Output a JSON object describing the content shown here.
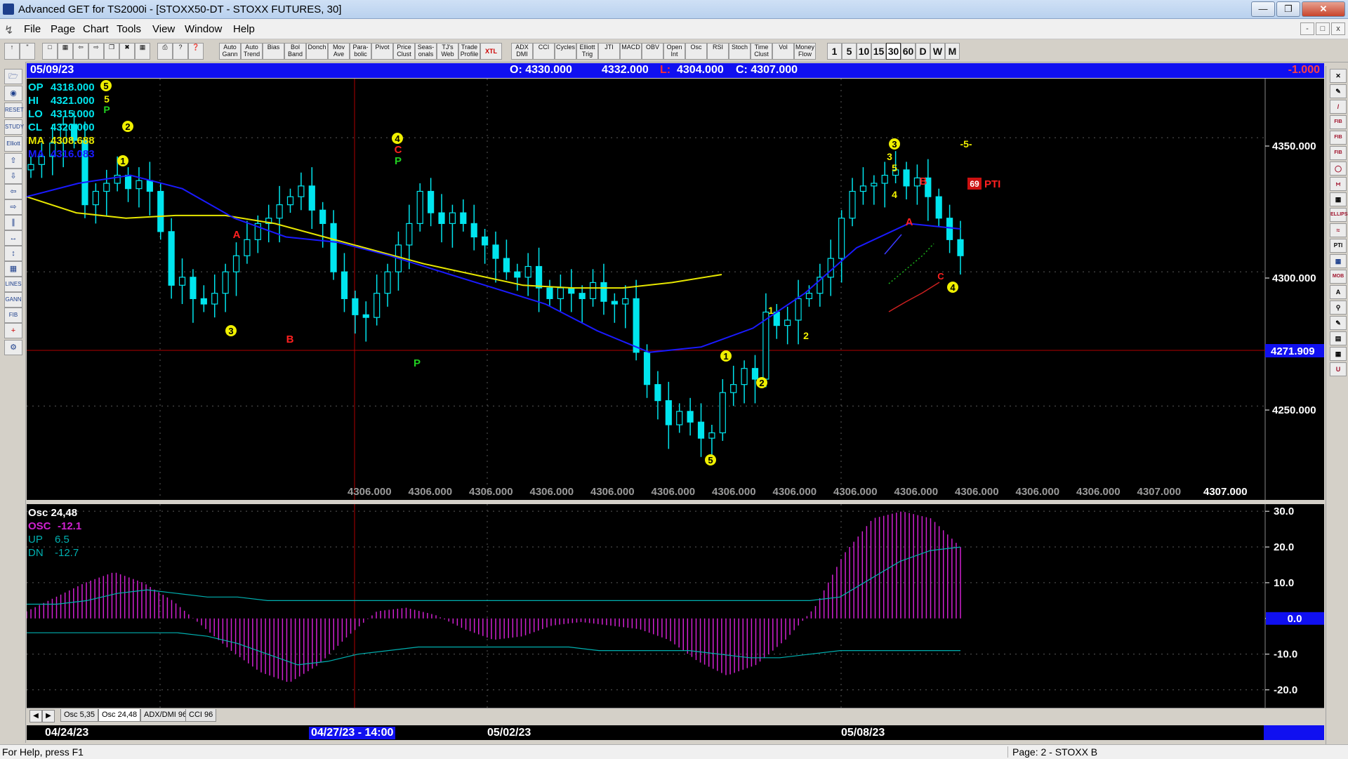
{
  "window": {
    "title": "Advanced GET for TS2000i - [STOXX50-DT - STOXX FUTURES, 30]"
  },
  "menu": [
    "File",
    "Page",
    "Chart",
    "Tools",
    "View",
    "Window",
    "Help"
  ],
  "toolbar": {
    "study_buttons": [
      "Auto Gann",
      "Auto Trend",
      "Bias",
      "Bol Band",
      "Donch",
      "Mov Ave",
      "Para- bolic",
      "Pivot",
      "Price Clust",
      "Seas- onals",
      "TJ's Web",
      "Trade Profile",
      "XTL",
      "ADX DMI",
      "CCI",
      "Cycles",
      "Elliott Trig",
      "JTI",
      "MACD",
      "OBV",
      "Open Int",
      "Osc",
      "RSI",
      "Stoch",
      "Time Clust",
      "Vol",
      "Money Flow"
    ],
    "periods": [
      "1",
      "5",
      "10",
      "15",
      "30",
      "60",
      "D",
      "W",
      "M"
    ],
    "active_period": "30"
  },
  "info_bar": {
    "date": "05/09/23",
    "open": "O: 4330.000",
    "high": "4332.000",
    "low": "L: 4304.000",
    "close": "C: 4307.000",
    "change": "-1.000"
  },
  "legend": {
    "op": {
      "label": "OP",
      "value": "4318.000"
    },
    "hi": {
      "label": "HI",
      "value": "4321.000"
    },
    "lo": {
      "label": "LO",
      "value": "4315.000"
    },
    "cl": {
      "label": "CL",
      "value": "4320.000"
    },
    "ma1": {
      "label": "MA",
      "value": "4308.688"
    },
    "ma2": {
      "label": "MA",
      "value": "4316.083"
    }
  },
  "price_axis": {
    "ticks": [
      "4350.000",
      "4300.000",
      "4250.000"
    ],
    "cursor_price": "4271.909"
  },
  "bottom_values": [
    "4306.000",
    "4306.000",
    "4306.000",
    "4306.000",
    "4306.000",
    "4306.000",
    "4306.000",
    "4306.000",
    "4306.000",
    "4306.000",
    "4306.000",
    "4306.000",
    "4306.000",
    "4307.000",
    "4307.000"
  ],
  "elliott_labels": {
    "wave5_top": "5",
    "wave3": "3",
    "wave4": "4",
    "wave5_low": "5",
    "wave1": "1",
    "wave2": "2",
    "wave3_top": "3",
    "wave4_end": "4",
    "waveA": "A",
    "waveB": "B",
    "waveC": "C",
    "pivotP": "P",
    "ptiValue": "69",
    "ptiText": "PTI",
    "wave5_target": "-5-",
    "small1": "1",
    "small2": "2",
    "small3": "3",
    "small4": "4",
    "small5": "5"
  },
  "oscillator": {
    "title": "Osc 24,48",
    "osc": {
      "label": "OSC",
      "value": "-12.1"
    },
    "up": {
      "label": "UP",
      "value": "6.5"
    },
    "dn": {
      "label": "DN",
      "value": "-12.7"
    },
    "ticks": [
      "30.0",
      "20.0",
      "10.0",
      "0.0",
      "-10.0",
      "-20.0"
    ]
  },
  "tabs": [
    "Osc 5,35",
    "Osc 24,48",
    "ADX/DMI 96",
    "CCI 96"
  ],
  "active_tab": "Osc 24,48",
  "date_axis": {
    "labels": [
      "04/24/23",
      "05/02/23",
      "05/08/23"
    ],
    "cursor_label": "04/27/23 - 14:00"
  },
  "status": {
    "help": "For Help, press F1",
    "page": "Page: 2 - STOXX B"
  },
  "colors": {
    "background": "#000000",
    "bars": "#00e5ee",
    "ma_fast": "#1a1aff",
    "ma_slow": "#e6e600",
    "osc_histogram": "#d020d0",
    "osc_signal": "#00b0b0",
    "cursor": "#b00000",
    "info_bar": "#1010f0"
  },
  "chart_data": {
    "type": "candlestick",
    "symbol": "STOXX50-DT",
    "interval": "30",
    "ylim": [
      4215,
      4372
    ],
    "price_series_approx": [
      4340,
      4343,
      4348,
      4355,
      4349,
      4325,
      4330,
      4333,
      4336,
      4331,
      4334,
      4330,
      4315,
      4295,
      4298,
      4290,
      4288,
      4292,
      4300,
      4306,
      4312,
      4318,
      4320,
      4325,
      4328,
      4332,
      4323,
      4318,
      4300,
      4290,
      4284,
      4283,
      4292,
      4300,
      4310,
      4318,
      4330,
      4322,
      4318,
      4322,
      4318,
      4313,
      4310,
      4305,
      4300,
      4298,
      4302,
      4294,
      4290,
      4294,
      4292,
      4290,
      4296,
      4289,
      4288,
      4290,
      4270,
      4258,
      4252,
      4243,
      4248,
      4244,
      4238,
      4240,
      4255,
      4258,
      4264,
      4260,
      4285,
      4280,
      4282,
      4290,
      4292,
      4298,
      4305,
      4320,
      4330,
      4332,
      4333,
      4336,
      4338,
      4332,
      4335,
      4328,
      4320,
      4312,
      4306
    ],
    "ma_fast_approx": [
      4328,
      4333,
      4336,
      4331,
      4320,
      4313,
      4311,
      4306,
      4300,
      4294,
      4288,
      4278,
      4270,
      4272,
      4279,
      4292,
      4309,
      4318,
      4316
    ],
    "ma_slow_approx": [
      4328,
      4322,
      4320,
      4321,
      4321,
      4318,
      4313,
      4308,
      4303,
      4299,
      4295,
      4294,
      4294,
      4296,
      4299
    ],
    "oscillator_histogram_approx": [
      2,
      6,
      10,
      13,
      10,
      5,
      -2,
      -9,
      -15,
      -18,
      -13,
      -5,
      2,
      3,
      1,
      -3,
      -6,
      -5,
      -2,
      -1,
      -2,
      -3,
      -6,
      -12,
      -16,
      -13,
      -6,
      3,
      18,
      28,
      30,
      28,
      20
    ],
    "dates": [
      "04/24/23",
      "04/27/23 - 14:00",
      "05/02/23",
      "05/08/23",
      "05/09/23"
    ]
  }
}
